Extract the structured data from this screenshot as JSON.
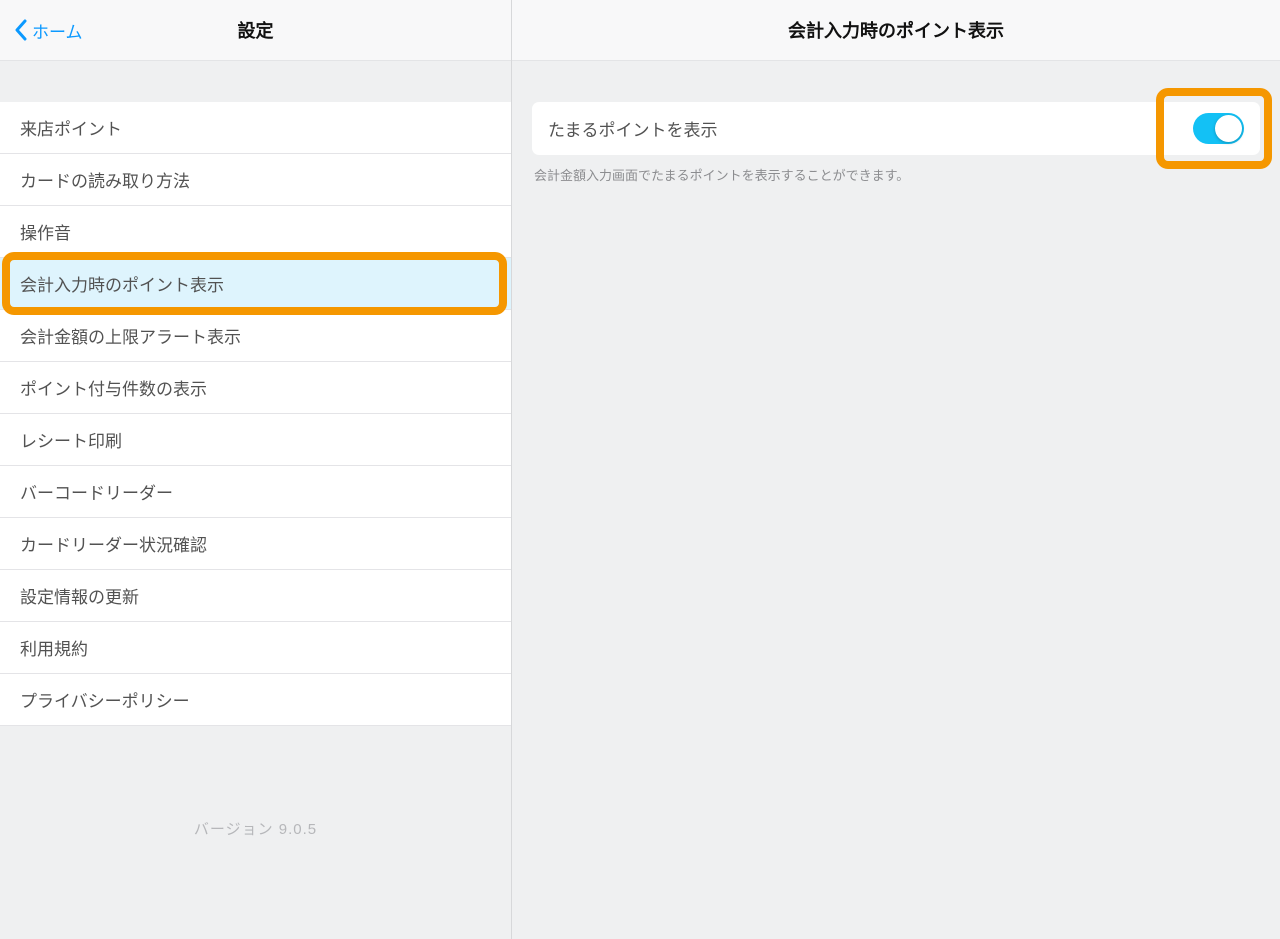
{
  "left": {
    "back_label": "ホーム",
    "title": "設定",
    "items": [
      {
        "label": "来店ポイント",
        "selected": false,
        "highlighted": false
      },
      {
        "label": "カードの読み取り方法",
        "selected": false,
        "highlighted": false
      },
      {
        "label": "操作音",
        "selected": false,
        "highlighted": false
      },
      {
        "label": "会計入力時のポイント表示",
        "selected": true,
        "highlighted": true
      },
      {
        "label": "会計金額の上限アラート表示",
        "selected": false,
        "highlighted": false
      },
      {
        "label": "ポイント付与件数の表示",
        "selected": false,
        "highlighted": false
      },
      {
        "label": "レシート印刷",
        "selected": false,
        "highlighted": false
      },
      {
        "label": "バーコードリーダー",
        "selected": false,
        "highlighted": false
      },
      {
        "label": "カードリーダー状況確認",
        "selected": false,
        "highlighted": false
      },
      {
        "label": "設定情報の更新",
        "selected": false,
        "highlighted": false
      },
      {
        "label": "利用規約",
        "selected": false,
        "highlighted": false
      },
      {
        "label": "プライバシーポリシー",
        "selected": false,
        "highlighted": false
      }
    ],
    "version": "バージョン 9.0.5"
  },
  "right": {
    "title": "会計入力時のポイント表示",
    "row_label": "たまるポイントを表示",
    "toggle_on": true,
    "hint": "会計金額入力画面でたまるポイントを表示することができます。"
  },
  "colors": {
    "accent": "#0b99ff",
    "toggle_on": "#13c1f5",
    "highlight": "#f59700"
  }
}
